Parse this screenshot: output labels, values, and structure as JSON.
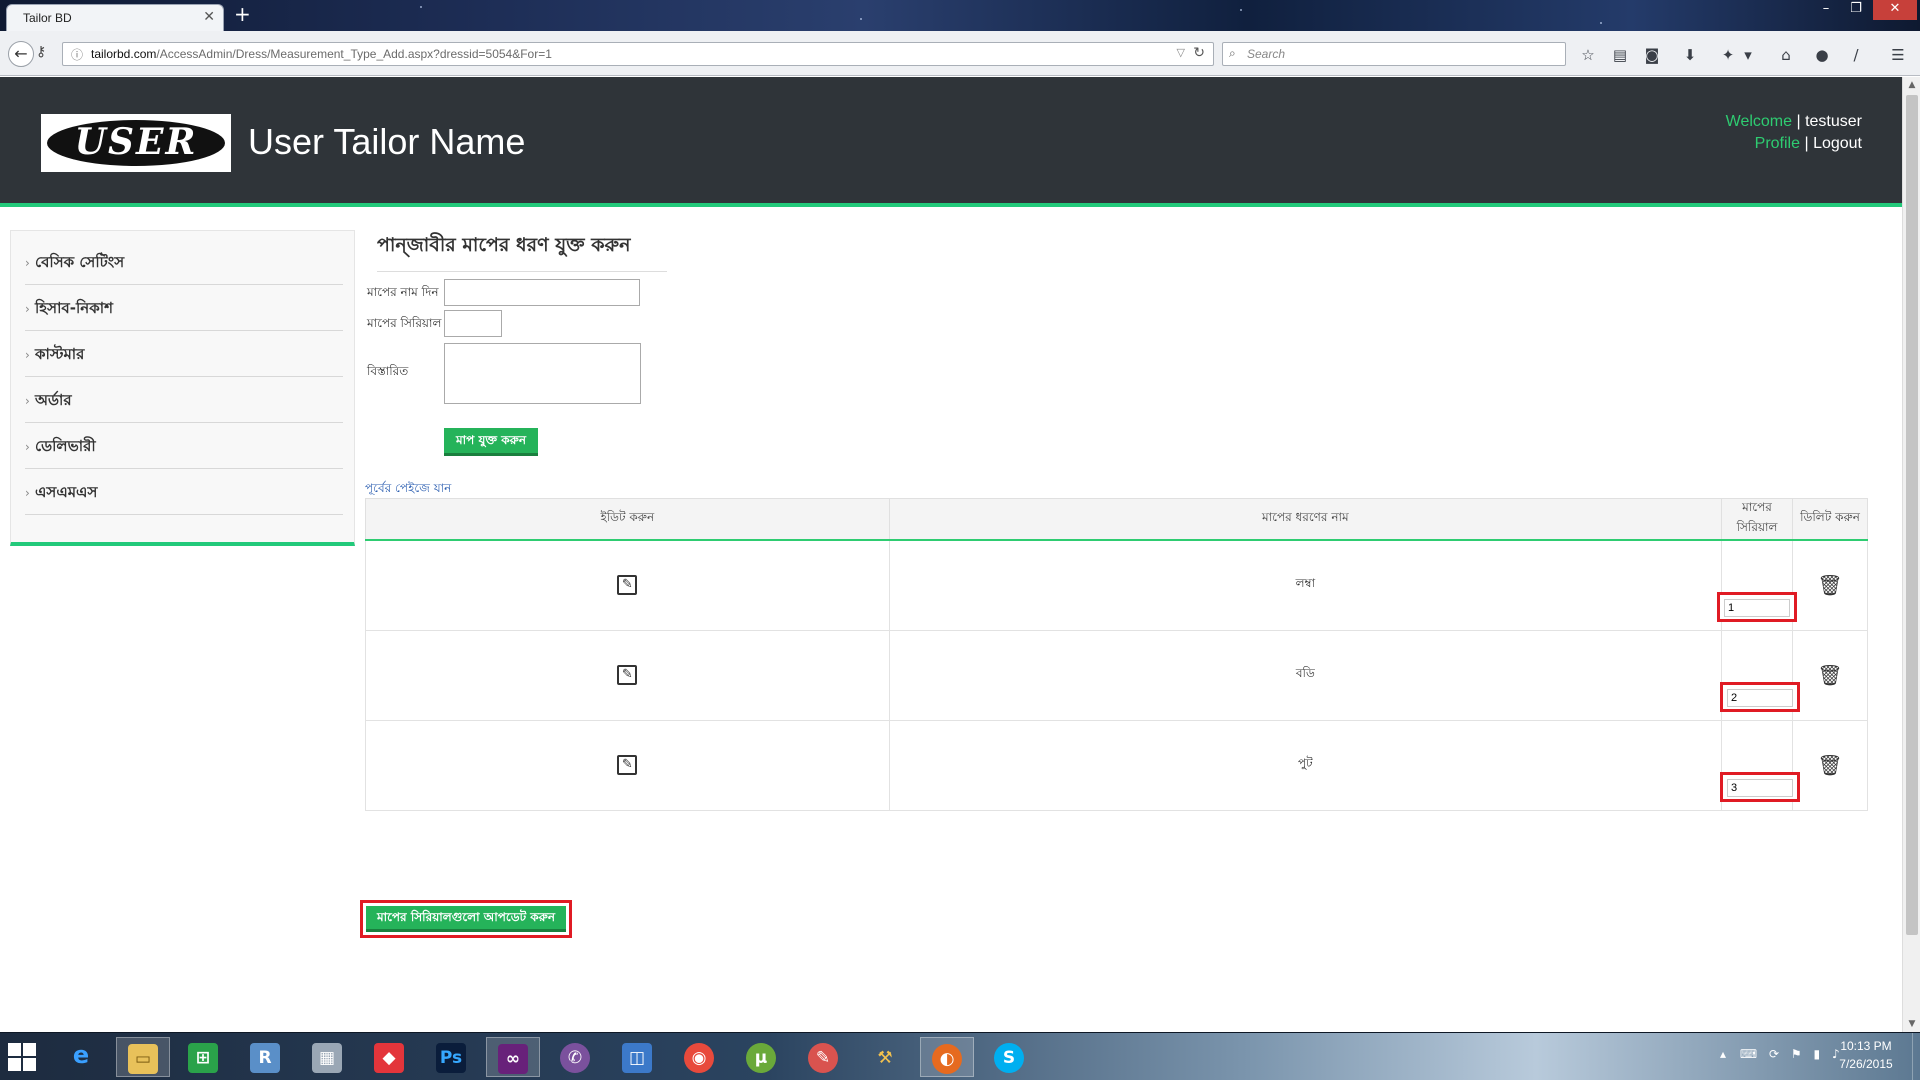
{
  "browser": {
    "tab_title": "Tailor BD",
    "url_host": "tailorbd.com",
    "url_path": "/AccessAdmin/Dress/Measurement_Type_Add.aspx?dressid=5054&For=1",
    "search_placeholder": "Search"
  },
  "header": {
    "logo_text": "USER",
    "site_title": "User Tailor Name",
    "welcome_label": "Welcome",
    "separator": "|",
    "username": "testuser",
    "profile_label": "Profile",
    "logout_label": "Logout"
  },
  "sidebar": {
    "items": [
      {
        "label": "বেসিক সেটিংস"
      },
      {
        "label": "হিসাব-নিকাশ"
      },
      {
        "label": "কাস্টমার"
      },
      {
        "label": "অর্ডার"
      },
      {
        "label": "ডেলিভারী"
      },
      {
        "label": "এসএমএস"
      }
    ]
  },
  "form": {
    "title": "পান্জাবীর মাপের ধরণ যুক্ত করুন",
    "name_label": "মাপের নাম দিন",
    "serial_label": "মাপের সিরিয়াল",
    "details_label": "বিস্তারিত",
    "add_button": "মাপ যুক্ত করুন",
    "back_link": "পূর্বের পেইজে যান"
  },
  "table": {
    "headers": {
      "edit": "ইডিট করুন",
      "name": "মাপের ধরণের নাম",
      "serial": "মাপের সিরিয়াল",
      "delete": "ডিলিট করুন"
    },
    "rows": [
      {
        "name": "লম্বা",
        "serial": "1"
      },
      {
        "name": "বডি",
        "serial": "2"
      },
      {
        "name": "পুট",
        "serial": "3"
      }
    ]
  },
  "update_button": "মাপের সিরিয়ালগুলো আপডেট করুন",
  "taskbar": {
    "clock_time": "10:13 PM",
    "clock_date": "7/26/2015"
  },
  "colors": {
    "accent_green": "#22c97a",
    "button_green": "#25b35a",
    "header_bg": "#2f3439",
    "highlight_red": "#e01b24"
  }
}
